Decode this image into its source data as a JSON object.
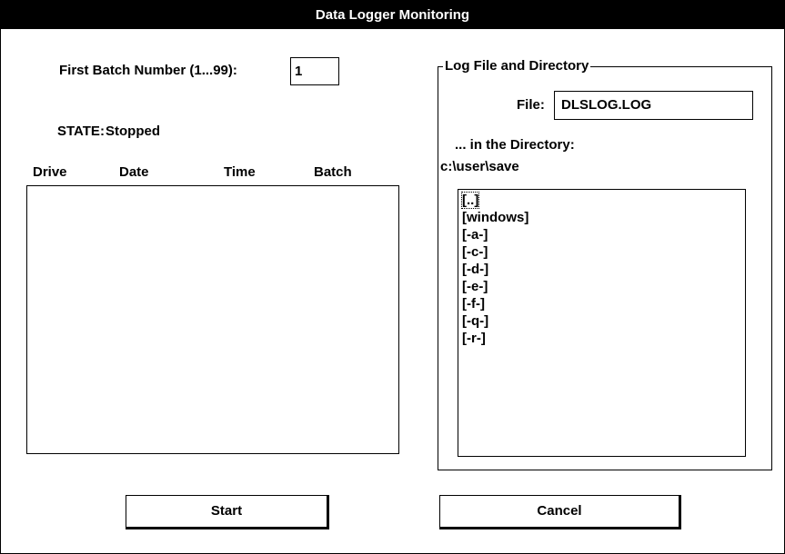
{
  "window": {
    "title": "Data Logger Monitoring"
  },
  "batch": {
    "label": "First Batch Number (1...99):",
    "value": "1"
  },
  "state": {
    "label": "STATE:",
    "value": "Stopped"
  },
  "log_table": {
    "columns": [
      "Drive",
      "Date",
      "Time",
      "Batch"
    ],
    "rows": []
  },
  "log_group": {
    "label": "Log File and Directory",
    "file_label": "File:",
    "file_value": "DLSLOG.LOG",
    "dir_label": "... in the Directory:",
    "dir_path": "c:\\user\\save",
    "dir_items": [
      "[..]",
      "[windows]",
      "[-a-]",
      "[-c-]",
      "[-d-]",
      "[-e-]",
      "[-f-]",
      "[-q-]",
      "[-r-]"
    ]
  },
  "buttons": {
    "start": "Start",
    "cancel": "Cancel"
  }
}
